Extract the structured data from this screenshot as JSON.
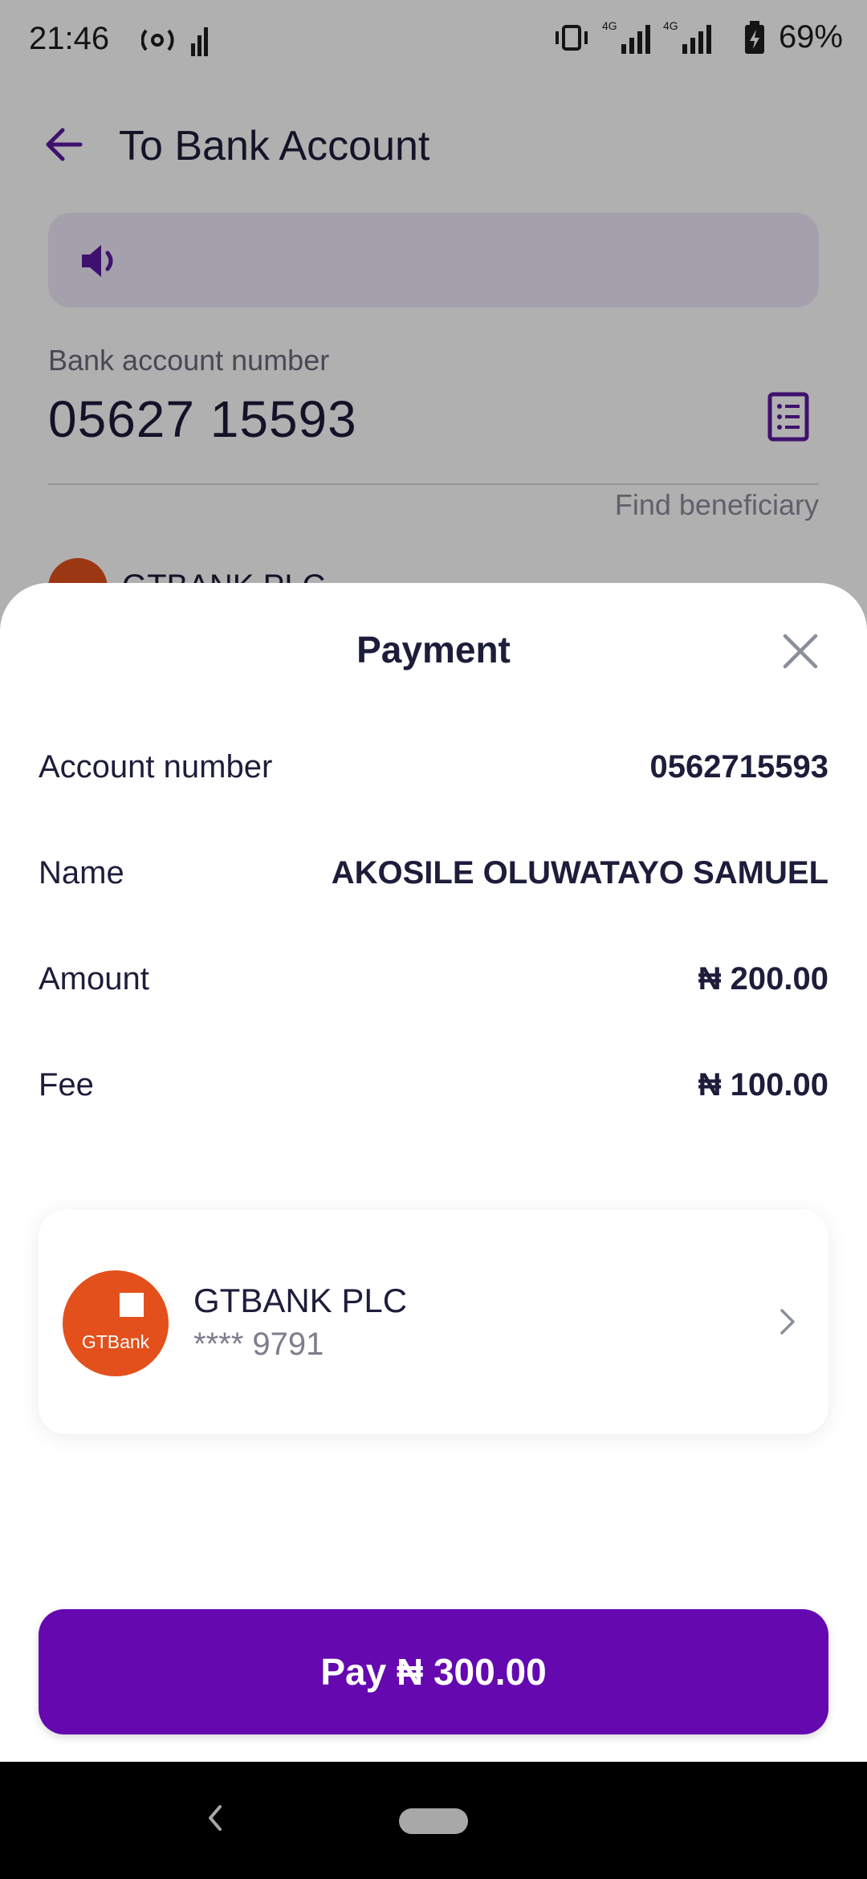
{
  "status_bar": {
    "time": "21:46",
    "battery": "69%",
    "network_label": "4G"
  },
  "background": {
    "header_title": "To Bank Account",
    "field_label": "Bank account number",
    "account_number_input": "05627 15593",
    "find_beneficiary": "Find beneficiary",
    "bank_peek_label": "GTBANK PLC"
  },
  "sheet": {
    "title": "Payment",
    "rows": [
      {
        "label": "Account number",
        "value": "0562715593"
      },
      {
        "label": "Name",
        "value": "AKOSILE OLUWATAYO SAMUEL"
      },
      {
        "label": "Amount",
        "value": "₦ 200.00"
      },
      {
        "label": "Fee",
        "value": "₦ 100.00"
      }
    ],
    "bank": {
      "logo_text": "GTBank",
      "name": "GTBANK PLC",
      "masked_number": "**** 9791"
    },
    "pay_button": "Pay ₦ 300.00"
  },
  "colors": {
    "accent": "#6508b0",
    "gtbank_orange": "#e3501c",
    "banner_bg": "#eee9fb"
  },
  "icons": {
    "back": "arrow-left-icon",
    "speaker": "speaker-icon",
    "list": "list-icon",
    "close": "close-icon",
    "chevron": "chevron-right-icon"
  }
}
